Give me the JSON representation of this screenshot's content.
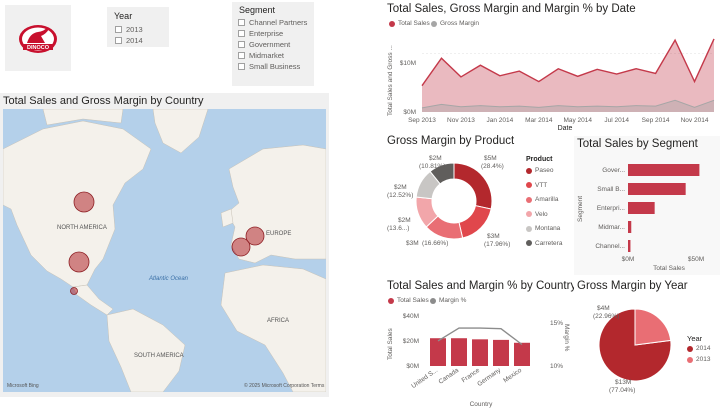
{
  "logo": {
    "text": "DINOCO",
    "color": "#c8102e"
  },
  "year_slicer": {
    "title": "Year",
    "options": [
      "2013",
      "2014"
    ]
  },
  "segment_slicer": {
    "title": "Segment",
    "options": [
      "Channel Partners",
      "Enterprise",
      "Government",
      "Midmarket",
      "Small Business"
    ]
  },
  "map": {
    "title": "Total Sales and Gross Margin by Country",
    "labels": {
      "na": "NORTH AMERICA",
      "eu": "EUROPE",
      "ocean": "Atlantic Ocean",
      "af": "AFRICA",
      "sa": "SOUTH AMERICA"
    },
    "bing": "Microsoft Bing",
    "copyright": "© 2025 Microsoft Corporation",
    "terms": "Terms"
  },
  "area": {
    "title": "Total Sales, Gross Margin and Margin % by Date",
    "legend": [
      "Total Sales",
      "Gross Margin"
    ],
    "ylabel": "Total Sales and Gross ...",
    "xlabel": "Date",
    "yticks": [
      "$10M",
      "$0M"
    ],
    "xticks": [
      "Sep 2013",
      "Nov 2013",
      "Jan 2014",
      "Mar 2014",
      "May 2014",
      "Jul 2014",
      "Sep 2014",
      "Nov 2014"
    ]
  },
  "donut": {
    "title": "Gross Margin by Product",
    "legend_title": "Product",
    "products": [
      "Paseo",
      "VTT",
      "Amarilla",
      "Velo",
      "Montana",
      "Carretera"
    ],
    "colors": [
      "#b3282d",
      "#e0474c",
      "#e96e74",
      "#f2a6aa",
      "#c8c6c4",
      "#605e5c"
    ],
    "labels": [
      {
        "v": "$5M",
        "p": "(28.4%)"
      },
      {
        "v": "$3M",
        "p": "(17.96%)"
      },
      {
        "v": "$3M",
        "p": "(16.66%)"
      },
      {
        "v": "$2M",
        "p": "(13.6...)"
      },
      {
        "v": "$2M",
        "p": "(12.52%)"
      },
      {
        "v": "$2M",
        "p": "(10.81%)"
      }
    ]
  },
  "segment_bar": {
    "title": "Total Sales by Segment",
    "categories": [
      "Gover...",
      "Small B...",
      "Enterpri...",
      "Midmar...",
      "Channel..."
    ],
    "ylabel": "Segment",
    "xlabel": "Total Sales",
    "xticks": [
      "$0M",
      "$50M"
    ]
  },
  "country_combo": {
    "title": "Total Sales and Margin % by Country",
    "legend": [
      "Total Sales",
      "Margin %"
    ],
    "categories": [
      "United S...",
      "Canada",
      "France",
      "Germany",
      "Mexico"
    ],
    "yticks": [
      "$40M",
      "$20M",
      "$0M"
    ],
    "y2ticks": [
      "15%",
      "10%"
    ],
    "ylabel": "Total Sales",
    "y2label": "Margin %",
    "xlabel": "Country"
  },
  "pie": {
    "title": "Gross Margin by Year",
    "legend_title": "Year",
    "years": [
      "2014",
      "2013"
    ],
    "colors": [
      "#b3282d",
      "#e96e74"
    ],
    "labels": [
      {
        "v": "$13M",
        "p": "(77.04%)"
      },
      {
        "v": "$4M",
        "p": "(22.96%)"
      }
    ]
  },
  "chart_data": [
    {
      "type": "area",
      "title": "Total Sales, Gross Margin and Margin % by Date",
      "xlabel": "Date",
      "ylabel": "Total Sales and Gross ...",
      "x": [
        "Sep 2013",
        "Oct 2013",
        "Nov 2013",
        "Dec 2013",
        "Jan 2014",
        "Feb 2014",
        "Mar 2014",
        "Apr 2014",
        "May 2014",
        "Jun 2014",
        "Jul 2014",
        "Aug 2014",
        "Sep 2014",
        "Oct 2014",
        "Nov 2014",
        "Dec 2014"
      ],
      "series": [
        {
          "name": "Total Sales",
          "color": "#c4394a",
          "values": [
            4.5,
            9.2,
            6.0,
            8.0,
            6.2,
            7.0,
            5.2,
            7.4,
            6.1,
            7.3,
            6.5,
            7.4,
            6.6,
            12.3,
            5.2,
            12.5
          ]
        },
        {
          "name": "Gross Margin",
          "color": "#a6a6a6",
          "values": [
            0.7,
            1.3,
            0.9,
            1.1,
            0.9,
            1.0,
            0.8,
            1.1,
            0.9,
            1.0,
            0.9,
            1.1,
            1.0,
            2.0,
            0.8,
            2.0
          ]
        }
      ],
      "ylim": [
        0,
        13
      ]
    },
    {
      "type": "donut",
      "title": "Gross Margin by Product",
      "categories": [
        "Paseo",
        "VTT",
        "Amarilla",
        "Velo",
        "Montana",
        "Carretera"
      ],
      "values": [
        28.4,
        17.96,
        16.66,
        13.65,
        12.52,
        10.81
      ]
    },
    {
      "type": "bar",
      "title": "Total Sales by Segment",
      "categories": [
        "Gover...",
        "Small B...",
        "Enterpri...",
        "Midmar...",
        "Channel..."
      ],
      "values": [
        52.5,
        42.4,
        19.6,
        2.4,
        1.8
      ],
      "xlim": [
        0,
        60
      ]
    },
    {
      "type": "bar",
      "title": "Total Sales and Margin % by Country",
      "categories": [
        "United S...",
        "Canada",
        "France",
        "Germany",
        "Mexico"
      ],
      "series": [
        {
          "name": "Total Sales",
          "color": "#c4394a",
          "values": [
            25,
            25,
            24,
            23.5,
            20.9
          ]
        },
        {
          "name": "Margin %",
          "color": "#8c8c8c",
          "values": [
            13.5,
            15.3,
            15.3,
            15.2,
            13.0
          ]
        }
      ],
      "ylim": [
        0,
        45
      ],
      "y2lim": [
        10,
        16
      ]
    },
    {
      "type": "pie",
      "title": "Gross Margin by Year",
      "categories": [
        "2014",
        "2013"
      ],
      "values": [
        77.04,
        22.96
      ]
    }
  ]
}
